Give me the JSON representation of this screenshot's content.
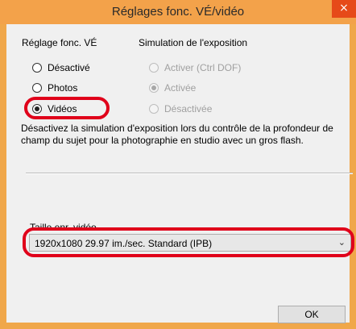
{
  "window": {
    "title": "Réglages fonc. VÉ/vidéo",
    "close_glyph": "×"
  },
  "group_ve": {
    "heading": "Réglage fonc. VÉ",
    "options": [
      {
        "label": "Désactivé",
        "checked": false
      },
      {
        "label": "Photos",
        "checked": false
      },
      {
        "label": "Vidéos",
        "checked": true
      }
    ]
  },
  "group_sim": {
    "heading": "Simulation de l'exposition",
    "options": [
      {
        "label": "Activer (Ctrl DOF)",
        "checked": false,
        "enabled": false
      },
      {
        "label": "Activée",
        "checked": true,
        "enabled": false
      },
      {
        "label": "Désactivée",
        "checked": false,
        "enabled": false
      }
    ]
  },
  "description": "Désactivez la simulation d'exposition lors du contrôle de la profondeur de champ du sujet pour la photographie en studio avec un gros flash.",
  "video_size": {
    "label": "Taille enr. vidéo",
    "selected": "1920x1080  29.97 im./sec. Standard (IPB)",
    "arrow_glyph": "⌄"
  },
  "ok_label": "OK",
  "colors": {
    "highlight": "#e0001a",
    "frame": "#f3a24a",
    "close": "#e64a19"
  }
}
